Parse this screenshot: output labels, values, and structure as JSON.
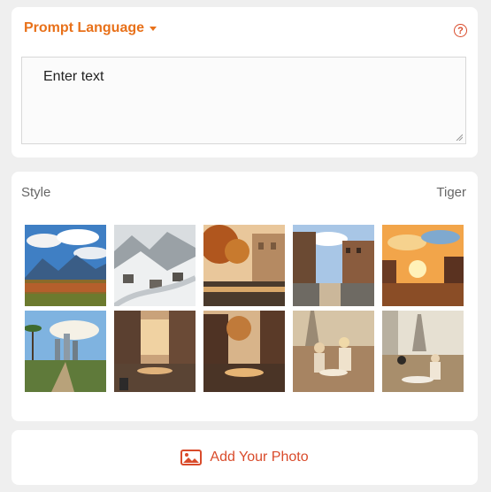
{
  "prompt_section": {
    "language_label": "Prompt Language",
    "help_symbol": "?",
    "input_value": "Enter text"
  },
  "style_section": {
    "label": "Style",
    "selected_style": "Tiger",
    "thumbnails": [
      "mountain-vineyard-landscape",
      "snowy-village-valley",
      "autumn-city-street",
      "sunlit-city-street",
      "sunset-street-scene",
      "palm-tree-city-view",
      "canal-city-view",
      "autumn-canal-view",
      "paris-cafe-scene",
      "eiffel-tower-cafe"
    ]
  },
  "add_photo": {
    "label": "Add Your Photo",
    "icon": "image-icon"
  },
  "colors": {
    "accent": "#e8711a",
    "icon_red": "#d94b2b",
    "background": "#efefef",
    "card": "#ffffff"
  }
}
